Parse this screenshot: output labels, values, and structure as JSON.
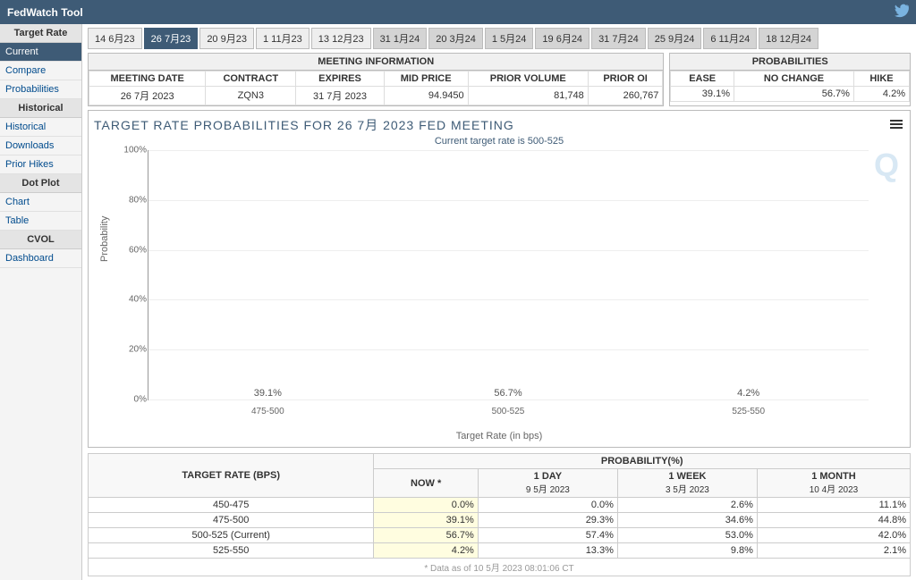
{
  "app": {
    "title": "FedWatch Tool"
  },
  "sidebar": {
    "groups": [
      {
        "title": "Target Rate",
        "items": [
          "Current",
          "Compare",
          "Probabilities"
        ]
      },
      {
        "title": "Historical",
        "items": [
          "Historical",
          "Downloads",
          "Prior Hikes"
        ]
      },
      {
        "title": "Dot Plot",
        "items": [
          "Chart",
          "Table"
        ]
      },
      {
        "title": "CVOL",
        "items": [
          "Dashboard"
        ]
      }
    ],
    "active": "Current"
  },
  "tabs": {
    "items": [
      "14 6月23",
      "26 7月23",
      "20 9月23",
      "1 11月23",
      "13 12月23",
      "31 1月24",
      "20 3月24",
      "1 5月24",
      "19 6月24",
      "31 7月24",
      "25 9月24",
      "6 11月24",
      "18 12月24"
    ],
    "active": "26 7月23",
    "muted_from_index": 5
  },
  "meeting_info": {
    "title": "MEETING INFORMATION",
    "headers": [
      "MEETING DATE",
      "CONTRACT",
      "EXPIRES",
      "MID PRICE",
      "PRIOR VOLUME",
      "PRIOR OI"
    ],
    "row": [
      "26 7月 2023",
      "ZQN3",
      "31 7月 2023",
      "94.9450",
      "81,748",
      "260,767"
    ]
  },
  "probabilities": {
    "title": "PROBABILITIES",
    "headers": [
      "EASE",
      "NO CHANGE",
      "HIKE"
    ],
    "row": [
      "39.1%",
      "56.7%",
      "4.2%"
    ]
  },
  "chart": {
    "title": "TARGET RATE PROBABILITIES FOR 26 7月 2023 FED MEETING",
    "subtitle": "Current target rate is 500-525",
    "ylabel": "Probability",
    "xlabel": "Target Rate (in bps)"
  },
  "chart_data": {
    "type": "bar",
    "categories": [
      "475-500",
      "500-525",
      "525-550"
    ],
    "values": [
      39.1,
      56.7,
      4.2
    ],
    "labels": [
      "39.1%",
      "56.7%",
      "4.2%"
    ],
    "title": "Target Rate Probabilities for 26 7月 2023 Fed Meeting",
    "xlabel": "Target Rate (in bps)",
    "ylabel": "Probability",
    "ylim": [
      0,
      100
    ],
    "yticks": [
      0,
      20,
      40,
      60,
      80,
      100
    ]
  },
  "prob_table": {
    "rate_header": "TARGET RATE (BPS)",
    "prob_header": "PROBABILITY(%)",
    "columns": [
      {
        "top": "NOW *",
        "sub": ""
      },
      {
        "top": "1 DAY",
        "sub": "9 5月 2023"
      },
      {
        "top": "1 WEEK",
        "sub": "3 5月 2023"
      },
      {
        "top": "1 MONTH",
        "sub": "10 4月 2023"
      }
    ],
    "rows": [
      {
        "rate": "450-475",
        "vals": [
          "0.0%",
          "0.0%",
          "2.6%",
          "11.1%"
        ]
      },
      {
        "rate": "475-500",
        "vals": [
          "39.1%",
          "29.3%",
          "34.6%",
          "44.8%"
        ]
      },
      {
        "rate": "500-525 (Current)",
        "vals": [
          "56.7%",
          "57.4%",
          "53.0%",
          "42.0%"
        ]
      },
      {
        "rate": "525-550",
        "vals": [
          "4.2%",
          "13.3%",
          "9.8%",
          "2.1%"
        ]
      }
    ],
    "footnote": "* Data as of 10 5月 2023 08:01:06 CT"
  }
}
